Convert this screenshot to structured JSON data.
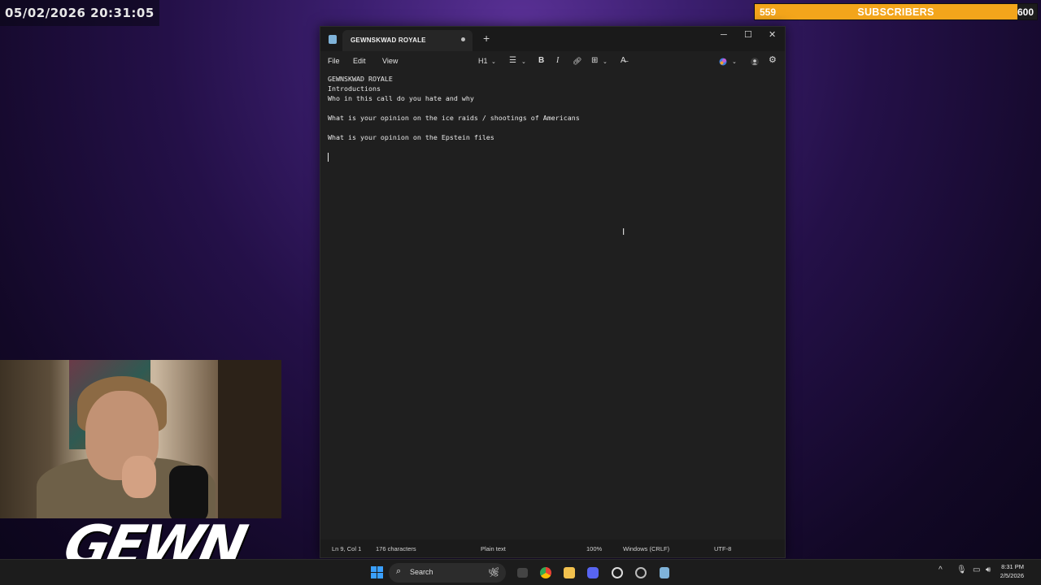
{
  "overlay": {
    "timestamp": "05/02/2026 20:31:05",
    "subs": {
      "current": "559",
      "title": "SUBSCRIBERS",
      "goal": "600",
      "progress": 0.93,
      "color": "#f3a51b"
    },
    "logo_text": "GEWN"
  },
  "notepad": {
    "tab_title": "GEWNSKWAD ROYALE",
    "new_tab": "+",
    "window_controls": {
      "minimize": "─",
      "maximize": "☐",
      "close": "✕"
    },
    "menu": {
      "file": "File",
      "edit": "Edit",
      "view": "View"
    },
    "toolbar": {
      "heading": "H1",
      "list": "☰",
      "bold": "B",
      "italic": "I",
      "link": "🔗︎",
      "table": "⊞",
      "clear": "A̶"
    },
    "content": [
      "GEWNSKWAD ROYALE",
      "Introductions",
      "Who in this call do you hate and why",
      "",
      "What is your opinion on the ice raids / shootings of Americans",
      "",
      "What is your opinion on the Epstein files",
      ""
    ],
    "status": {
      "position": "Ln 9, Col 1",
      "chars": "176 characters",
      "format": "Plain text",
      "zoom": "100%",
      "line_ending": "Windows (CRLF)",
      "encoding": "UTF-8"
    }
  },
  "taskbar": {
    "search_label": "Search",
    "time": "8:31 PM",
    "date": "2/5/2026"
  }
}
